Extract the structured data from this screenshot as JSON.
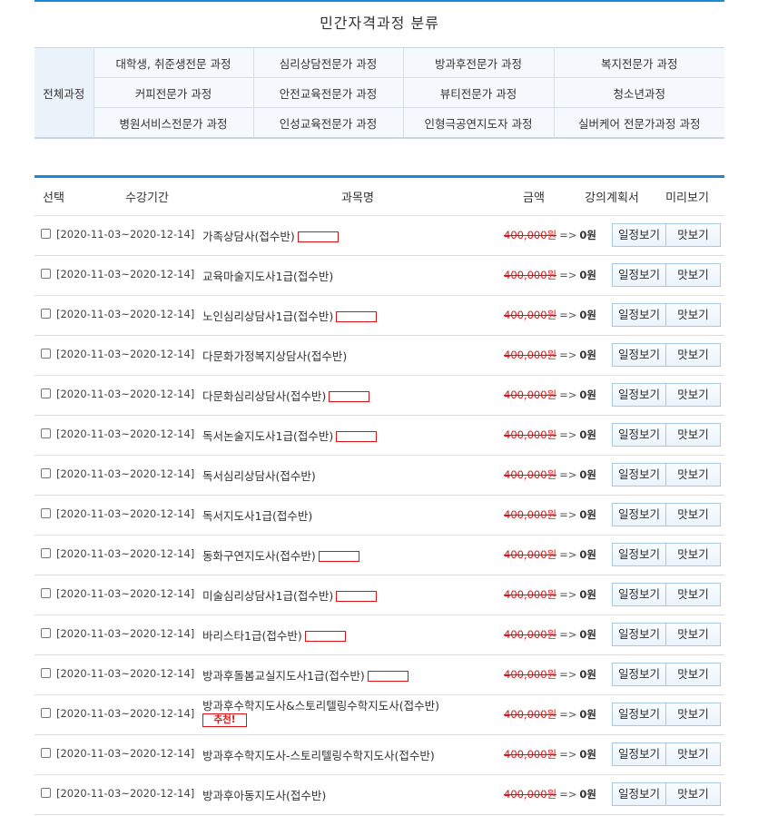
{
  "category": {
    "title": "민간자격과정 분류",
    "all_label": "전체과정",
    "rows": [
      [
        "대학생, 취준생전문 과정",
        "심리상담전문가 과정",
        "방과후전문가 과정",
        "복지전문가 과정"
      ],
      [
        "커피전문가 과정",
        "안전교육전문가 과정",
        "뷰티전문가 과정",
        "청소년과정"
      ],
      [
        "병원서비스전문가 과정",
        "인성교육전문가 과정",
        "인형극공연지도자 과정",
        "실버케어 전문가과정 과정"
      ]
    ]
  },
  "list": {
    "headers": {
      "select": "선택",
      "period": "수강기간",
      "name": "과목명",
      "price": "금액",
      "plan": "강의계획서",
      "preview": "미리보기"
    },
    "buttons": {
      "plan": "일정보기",
      "preview": "맛보기"
    },
    "arrow": "=>",
    "courses": [
      {
        "period": "[2020-11-03~2020-12-14]",
        "name": "가족상담사(접수반)",
        "old_price": "400,000원",
        "price": "0원",
        "marker": true
      },
      {
        "period": "[2020-11-03~2020-12-14]",
        "name": "교육마술지도사1급(접수반)",
        "old_price": "400,000원",
        "price": "0원",
        "marker": false
      },
      {
        "period": "[2020-11-03~2020-12-14]",
        "name": "노인심리상담사1급(접수반)",
        "old_price": "400,000원",
        "price": "0원",
        "marker": true
      },
      {
        "period": "[2020-11-03~2020-12-14]",
        "name": "다문화가정복지상담사(접수반)",
        "old_price": "400,000원",
        "price": "0원",
        "marker": false
      },
      {
        "period": "[2020-11-03~2020-12-14]",
        "name": "다문화심리상담사(접수반)",
        "old_price": "400,000원",
        "price": "0원",
        "marker": true
      },
      {
        "period": "[2020-11-03~2020-12-14]",
        "name": "독서논술지도사1급(접수반)",
        "old_price": "400,000원",
        "price": "0원",
        "marker": true
      },
      {
        "period": "[2020-11-03~2020-12-14]",
        "name": "독서심리상담사(접수반)",
        "old_price": "400,000원",
        "price": "0원",
        "marker": false
      },
      {
        "period": "[2020-11-03~2020-12-14]",
        "name": "독서지도사1급(접수반)",
        "old_price": "400,000원",
        "price": "0원",
        "marker": false
      },
      {
        "period": "[2020-11-03~2020-12-14]",
        "name": "동화구연지도사(접수반)",
        "old_price": "400,000원",
        "price": "0원",
        "marker": true
      },
      {
        "period": "[2020-11-03~2020-12-14]",
        "name": "미술심리상담사1급(접수반)",
        "old_price": "400,000원",
        "price": "0원",
        "marker": true
      },
      {
        "period": "[2020-11-03~2020-12-14]",
        "name": "바리스타1급(접수반)",
        "old_price": "400,000원",
        "price": "0원",
        "marker": true
      },
      {
        "period": "[2020-11-03~2020-12-14]",
        "name": "방과후돌봄교실지도사1급(접수반)",
        "old_price": "400,000원",
        "price": "0원",
        "marker": true
      },
      {
        "period": "[2020-11-03~2020-12-14]",
        "name": "방과후수학지도사&스토리텔링수학지도사(접수반)",
        "old_price": "400,000원",
        "price": "0원",
        "marker": false,
        "badge": "추천!"
      },
      {
        "period": "[2020-11-03~2020-12-14]",
        "name": "방과후수학지도사-스토리텔링수학지도사(접수반)",
        "old_price": "400,000원",
        "price": "0원",
        "marker": false
      },
      {
        "period": "[2020-11-03~2020-12-14]",
        "name": "방과후아동지도사(접수반)",
        "old_price": "400,000원",
        "price": "0원",
        "marker": false
      }
    ]
  }
}
